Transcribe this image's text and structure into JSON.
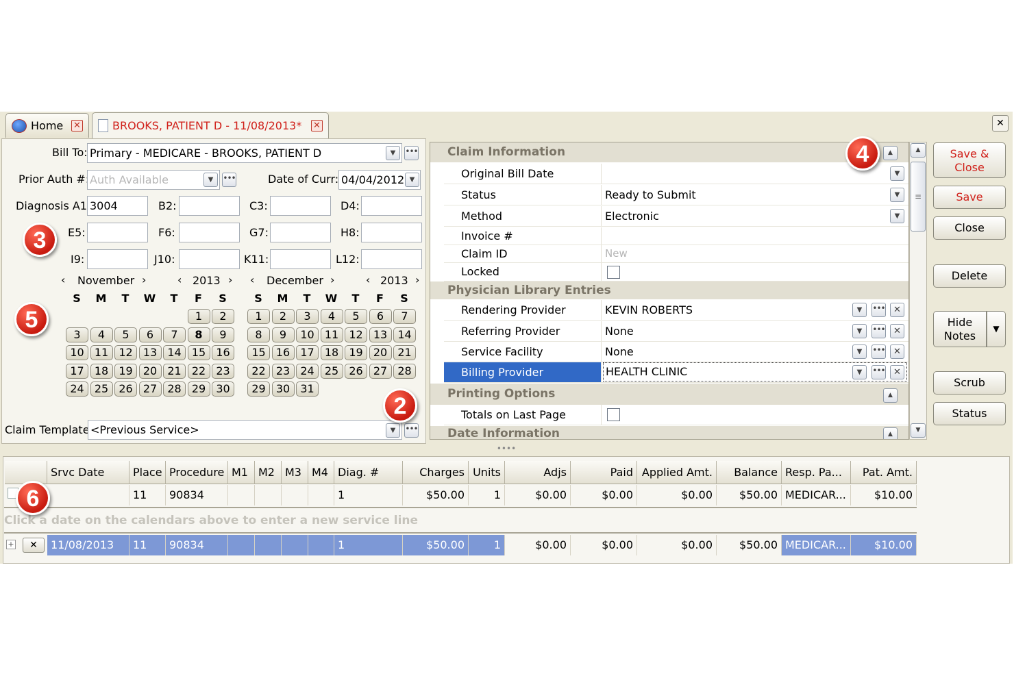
{
  "tabs": [
    {
      "label": "Home"
    },
    {
      "label": "BROOKS, PATIENT D - 11/08/2013*"
    }
  ],
  "header": {
    "bill_to_label": "Bill To:",
    "bill_to_value": "Primary - MEDICARE - BROOKS, PATIENT D",
    "prior_auth_label": "Prior Auth #:",
    "prior_auth_placeholder": "Auth Available",
    "date_of_curr_label": "Date of Curr:",
    "date_of_curr_value": "04/04/2012"
  },
  "diagnosis": [
    {
      "label": "Diagnosis A1:",
      "value": "3004"
    },
    {
      "label": "B2:",
      "value": ""
    },
    {
      "label": "C3:",
      "value": ""
    },
    {
      "label": "D4:",
      "value": ""
    },
    {
      "label": "E5:",
      "value": ""
    },
    {
      "label": "F6:",
      "value": ""
    },
    {
      "label": "G7:",
      "value": ""
    },
    {
      "label": "H8:",
      "value": ""
    },
    {
      "label": "I9:",
      "value": ""
    },
    {
      "label": "J10:",
      "value": ""
    },
    {
      "label": "K11:",
      "value": ""
    },
    {
      "label": "L12:",
      "value": ""
    }
  ],
  "calendars": [
    {
      "month": "November",
      "year": "2013",
      "days_of_week": [
        "S",
        "M",
        "T",
        "W",
        "T",
        "F",
        "S"
      ],
      "weeks": [
        [
          "",
          "",
          "",
          "",
          "",
          "1",
          "2"
        ],
        [
          "3",
          "4",
          "5",
          "6",
          "7",
          "8",
          "9"
        ],
        [
          "10",
          "11",
          "12",
          "13",
          "14",
          "15",
          "16"
        ],
        [
          "17",
          "18",
          "19",
          "20",
          "21",
          "22",
          "23"
        ],
        [
          "24",
          "25",
          "26",
          "27",
          "28",
          "29",
          "30"
        ]
      ],
      "bold_day": "8"
    },
    {
      "month": "December",
      "year": "2013",
      "days_of_week": [
        "S",
        "M",
        "T",
        "W",
        "T",
        "F",
        "S"
      ],
      "weeks": [
        [
          "1",
          "2",
          "3",
          "4",
          "5",
          "6",
          "7"
        ],
        [
          "8",
          "9",
          "10",
          "11",
          "12",
          "13",
          "14"
        ],
        [
          "15",
          "16",
          "17",
          "18",
          "19",
          "20",
          "21"
        ],
        [
          "22",
          "23",
          "24",
          "25",
          "26",
          "27",
          "28"
        ],
        [
          "29",
          "30",
          "31",
          "",
          "",
          "",
          ""
        ]
      ],
      "bold_day": ""
    }
  ],
  "claim_template": {
    "label": "Claim Template:",
    "value": "<Previous Service>"
  },
  "callouts": [
    "2",
    "3",
    "4",
    "5",
    "6"
  ],
  "property_grid": {
    "claim_information": "Claim Information",
    "original_bill_date_label": "Original Bill Date",
    "original_bill_date_value": "",
    "status_label": "Status",
    "status_value": "Ready to Submit",
    "method_label": "Method",
    "method_value": "Electronic",
    "invoice_label": "Invoice #",
    "invoice_value": "",
    "claim_id_label": "Claim ID",
    "claim_id_value": "New",
    "locked_label": "Locked",
    "physician_library": "Physician Library Entries",
    "rendering_label": "Rendering Provider",
    "rendering_value": "KEVIN ROBERTS",
    "referring_label": "Referring Provider",
    "referring_value": "None",
    "service_facility_label": "Service Facility",
    "service_facility_value": "None",
    "billing_label": "Billing Provider",
    "billing_value": "HEALTH CLINIC",
    "printing_options": "Printing Options",
    "totals_label": "Totals on Last Page",
    "date_information": "Date Information"
  },
  "side_buttons": {
    "save_close": "Save & Close",
    "save": "Save",
    "close": "Close",
    "delete": "Delete",
    "hide_notes": "Hide Notes",
    "scrub": "Scrub",
    "status": "Status"
  },
  "grid": {
    "columns": [
      "Srvc Date",
      "Place",
      "Procedure",
      "M1",
      "M2",
      "M3",
      "M4",
      "Diag. #",
      "Charges",
      "Units",
      "Adjs",
      "Paid",
      "Applied Amt.",
      "Balance",
      "Resp. Pa...",
      "Pat. Amt."
    ],
    "row1": [
      "",
      "11",
      "90834",
      "",
      "",
      "",
      "",
      "1",
      "$50.00",
      "1",
      "$0.00",
      "$0.00",
      "$0.00",
      "$50.00",
      "MEDICAR...",
      "$10.00"
    ],
    "hint": "Click a date on the calendars above to enter a new service line",
    "row2": [
      "11/08/2013",
      "11",
      "90834",
      "",
      "",
      "",
      "",
      "1",
      "$50.00",
      "1",
      "$0.00",
      "$0.00",
      "$0.00",
      "$50.00",
      "MEDICAR...",
      "$10.00"
    ]
  },
  "colors": {
    "accent": "#3169c6",
    "tab_active_text": "#d0201a",
    "save_text": "#d0201a",
    "row_selected": "#7d98d6"
  }
}
